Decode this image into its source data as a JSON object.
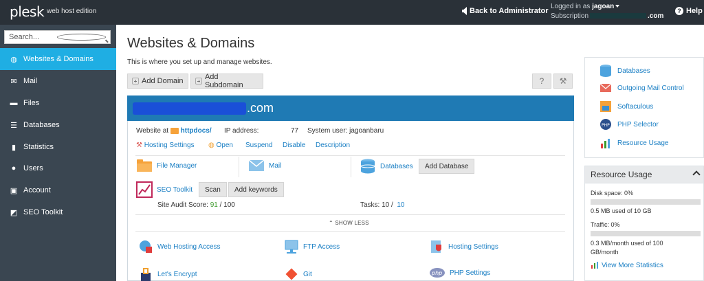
{
  "topbar": {
    "logo": "plesk",
    "edition": "web host edition",
    "back_admin": "Back to Administrator",
    "logged_in_label": "Logged in as",
    "user": "jagoan",
    "subscription_label": "Subscription",
    "subscription_suffix": ".com",
    "help": "Help"
  },
  "sidebar": {
    "search_placeholder": "Search...",
    "items": [
      {
        "label": "Websites & Domains",
        "icon": "globe-icon"
      },
      {
        "label": "Mail",
        "icon": "envelope-icon"
      },
      {
        "label": "Files",
        "icon": "folder-icon"
      },
      {
        "label": "Databases",
        "icon": "database-icon"
      },
      {
        "label": "Statistics",
        "icon": "bar-chart-icon"
      },
      {
        "label": "Users",
        "icon": "user-icon"
      },
      {
        "label": "Account",
        "icon": "account-icon"
      },
      {
        "label": "SEO Toolkit",
        "icon": "seo-icon"
      }
    ],
    "active_index": 0
  },
  "main": {
    "title": "Websites & Domains",
    "description": "This is where you set up and manage websites.",
    "buttons": {
      "add_domain": "Add Domain",
      "add_subdomain": "Add Subdomain",
      "help": "?",
      "tools": "⚒"
    },
    "domain": {
      "tld": ".com",
      "website_at": "Website at",
      "docroot": "httpdocs/",
      "ip_label": "IP address:",
      "ip_suffix": "77",
      "system_user_label": "System user:",
      "system_user": "jagoanbaru",
      "actions": [
        "Hosting Settings",
        "Open",
        "Suspend",
        "Disable",
        "Description"
      ],
      "tools": {
        "file_manager": "File Manager",
        "mail": "Mail",
        "databases": "Databases",
        "add_database": "Add Database",
        "seo_toolkit": "SEO Toolkit",
        "scan": "Scan",
        "add_keywords": "Add keywords"
      },
      "audit_label": "Site Audit Score:",
      "audit_score": "91",
      "audit_max": "/ 100",
      "tasks_label": "Tasks:",
      "tasks_done": "10",
      "tasks_sep": "/",
      "tasks_total": "10",
      "show_less": "SHOW LESS",
      "more_tools": [
        "Web Hosting Access",
        "FTP Access",
        "Hosting Settings",
        "Let's Encrypt",
        "Git",
        "PHP Settings"
      ]
    }
  },
  "right_panel": {
    "links": [
      "Databases",
      "Outgoing Mail Control",
      "Softaculous",
      "PHP Selector",
      "Resource Usage"
    ],
    "resource_usage": {
      "title": "Resource Usage",
      "disk_label": "Disk space: 0%",
      "disk_used": "0.5 MB used of 10 GB",
      "disk_fraction": 0.0,
      "traffic_label": "Traffic: 0%",
      "traffic_used_1": "0.3 MB/month used of 100",
      "traffic_used_2": "GB/month",
      "traffic_fraction": 0.0,
      "more_stats": "View More Statistics"
    }
  },
  "colors": {
    "topbar": "#2a3138",
    "sidebar": "#3a4651",
    "active": "#1faee3",
    "domain_header": "#1f7ab4",
    "link": "#1a7fc4",
    "score_green": "#3c9a2b"
  }
}
